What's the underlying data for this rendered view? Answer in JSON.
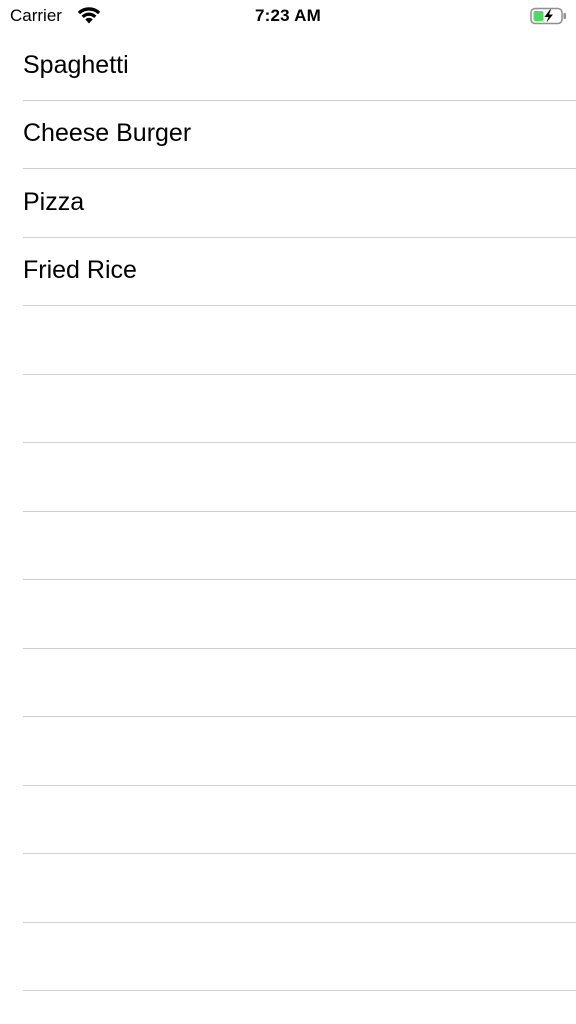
{
  "status_bar": {
    "carrier": "Carrier",
    "time": "7:23 AM",
    "wifi_icon": "wifi-icon",
    "battery_icon": "battery-charging-icon",
    "battery_color": "#4cd964"
  },
  "list": {
    "items": [
      {
        "label": "Spaghetti"
      },
      {
        "label": "Cheese Burger"
      },
      {
        "label": "Pizza"
      },
      {
        "label": "Fried Rice"
      }
    ]
  }
}
